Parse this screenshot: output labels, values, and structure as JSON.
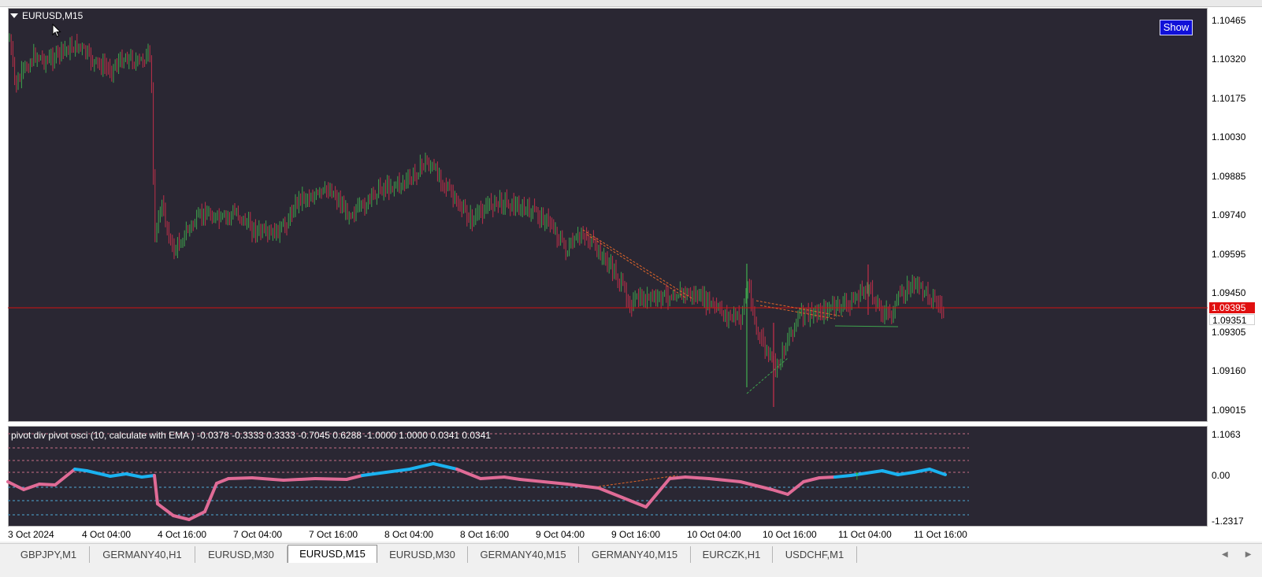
{
  "window": {
    "chart_title": "EURUSD,M15",
    "show_button": "Show",
    "indicator_title": "pivot div pivot osci (10, calculate with EMA ) -0.0378 -0.3333 0.3333 -0.7045 0.6288 -1.0000 1.0000 0.0341 0.0341"
  },
  "price_axis": {
    "ticks": [
      "1.10465",
      "1.10320",
      "1.10175",
      "1.10030",
      "1.09885",
      "1.09740",
      "1.09595",
      "1.09450",
      "1.09305",
      "1.09160",
      "1.09015"
    ],
    "bid_label": "1.09395",
    "ask_label": "1.09351"
  },
  "osc_axis": {
    "ticks": [
      "1.1063",
      "0.00",
      "-1.2317"
    ]
  },
  "time_axis": {
    "labels": [
      "3 Oct 2024",
      "4 Oct 04:00",
      "4 Oct 16:00",
      "7 Oct 04:00",
      "7 Oct 16:00",
      "8 Oct 04:00",
      "8 Oct 16:00",
      "9 Oct 04:00",
      "9 Oct 16:00",
      "10 Oct 04:00",
      "10 Oct 16:00",
      "11 Oct 04:00",
      "11 Oct 16:00"
    ]
  },
  "tabs": [
    {
      "label": "GBPJPY,M1",
      "active": false
    },
    {
      "label": "GERMANY40,H1",
      "active": false
    },
    {
      "label": "EURUSD,M30",
      "active": false
    },
    {
      "label": "EURUSD,M15",
      "active": true
    },
    {
      "label": "EURUSD,M30",
      "active": false
    },
    {
      "label": "GERMANY40,M15",
      "active": false
    },
    {
      "label": "GERMANY40,M15",
      "active": false
    },
    {
      "label": "EURCZK,H1",
      "active": false
    },
    {
      "label": "USDCHF,M1",
      "active": false
    }
  ],
  "colors": {
    "background": "#2a2733",
    "bull_candle": "#3fa34d",
    "bear_candle": "#c0304a",
    "bid_line": "#d01010",
    "osc_up": "#1ab2f0",
    "osc_down": "#e06b96",
    "level_line_upper": "#c76f86",
    "level_line_lower": "#4ea9d6"
  }
}
